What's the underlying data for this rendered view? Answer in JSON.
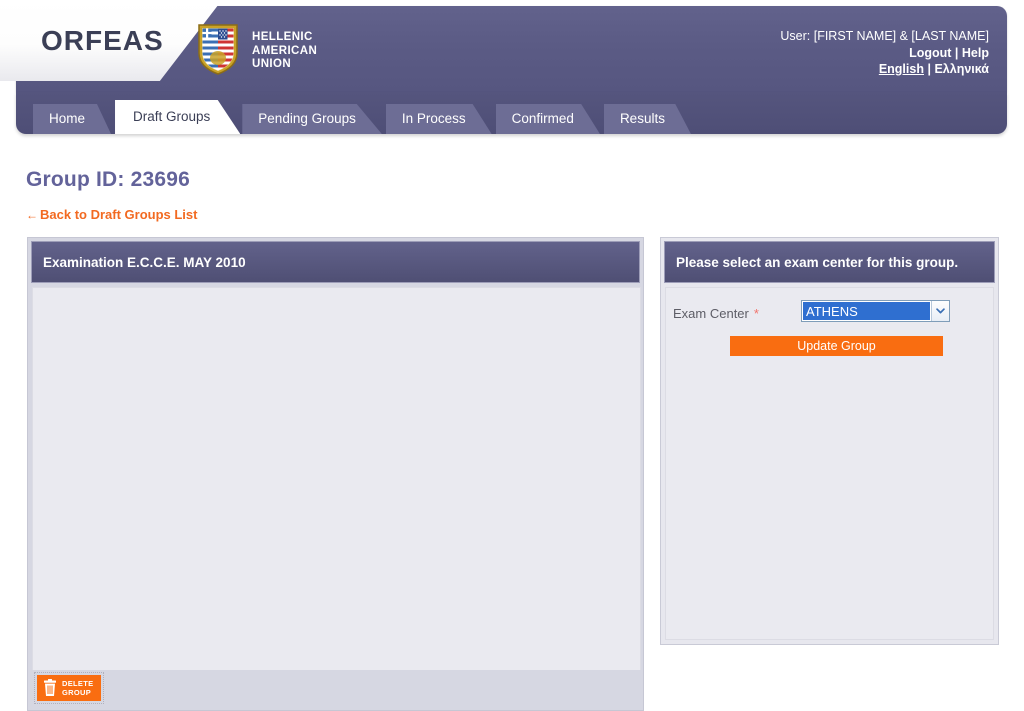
{
  "brand": {
    "name": "ORFEAS",
    "org_line1": "HELLENIC",
    "org_line2": "AMERICAN",
    "org_line3": "UNION"
  },
  "header": {
    "user_label": "User: [FIRST NAME] & [LAST NAME]",
    "logout": "Logout",
    "help": "Help",
    "lang_en": "English",
    "lang_el": "Ελληνικά",
    "separator": "|"
  },
  "tabs": [
    {
      "label": "Home",
      "active": false
    },
    {
      "label": "Draft Groups",
      "active": true
    },
    {
      "label": "Pending Groups",
      "active": false
    },
    {
      "label": "In Process",
      "active": false
    },
    {
      "label": "Confirmed",
      "active": false
    },
    {
      "label": "Results",
      "active": false
    }
  ],
  "page": {
    "title": "Group ID: 23696",
    "back_link": "Back to Draft Groups List",
    "back_arrow": "←"
  },
  "left_panel": {
    "header": "Examination E.C.C.E. MAY 2010",
    "delete_line1": "DELETE",
    "delete_line2": "GROUP"
  },
  "right_panel": {
    "header": "Please select an exam center for this group.",
    "field_label": "Exam Center",
    "required_marker": "*",
    "exam_center_value": "ATHENS",
    "update_button": "Update Group"
  },
  "colors": {
    "header_purple": "#5b5b85",
    "tabbar_purple": "#4e4e76",
    "panel_head": "#5a5a80",
    "accent_orange": "#f96d11",
    "title_purple": "#63639a",
    "select_highlight": "#2f6fd0"
  }
}
